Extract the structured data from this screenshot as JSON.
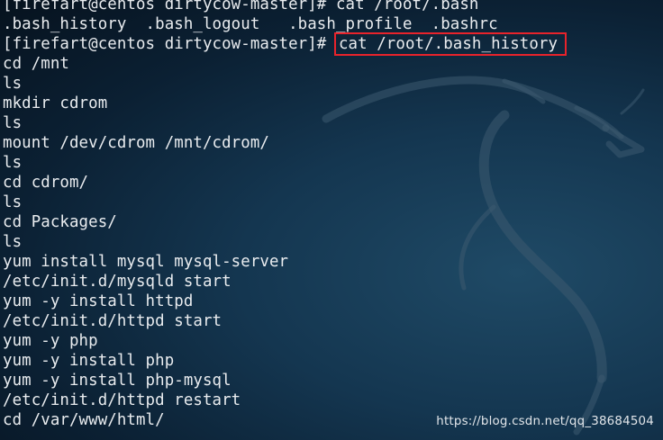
{
  "terminal": {
    "lines": [
      {
        "text": "[firefart@centos dirtycow-master]# cat /root/.bash"
      },
      {
        "text": ".bash_history  .bash_logout   .bash_profile  .bashrc"
      },
      {
        "prompt": "[firefart@centos dirtycow-master]# ",
        "command": "cat /root/.bash_history"
      },
      {
        "text": "cd /mnt"
      },
      {
        "text": "ls"
      },
      {
        "text": "mkdir cdrom"
      },
      {
        "text": "ls"
      },
      {
        "text": "mount /dev/cdrom /mnt/cdrom/"
      },
      {
        "text": "ls"
      },
      {
        "text": "cd cdrom/"
      },
      {
        "text": "ls"
      },
      {
        "text": "cd Packages/"
      },
      {
        "text": "ls"
      },
      {
        "text": "yum install mysql mysql-server"
      },
      {
        "text": "/etc/init.d/mysqld start"
      },
      {
        "text": "yum -y install httpd"
      },
      {
        "text": "/etc/init.d/httpd start"
      },
      {
        "text": "yum -y php"
      },
      {
        "text": "yum -y install php"
      },
      {
        "text": "yum -y install php-mysql"
      },
      {
        "text": "/etc/init.d/httpd restart"
      },
      {
        "text": "cd /var/www/html/"
      }
    ]
  },
  "watermark": "https://blog.csdn.net/qq_38684504",
  "colors": {
    "text": "#e9ecef",
    "highlight_box": "#e8232b",
    "background": "#143650"
  },
  "decor": {
    "background_art": "kali-dragon-logo"
  }
}
